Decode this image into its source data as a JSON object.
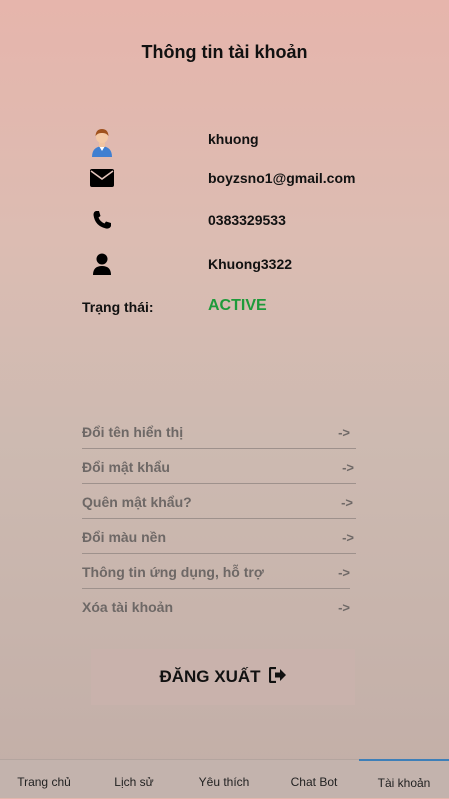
{
  "page": {
    "title": "Thông tin tài khoản"
  },
  "profile": {
    "name": "khuong",
    "email": "boyzsno1@gmail.com",
    "phone": "0383329533",
    "username": "Khuong3322",
    "status_label": "Trạng thái:",
    "status_value": "ACTIVE",
    "status_color": "#1e9a3a"
  },
  "icons": {
    "avatar": "user-avatar-icon",
    "email": "envelope-icon",
    "phone": "phone-icon",
    "username": "person-icon",
    "logout": "sign-out-icon"
  },
  "menu": [
    {
      "label": "Đổi tên hiển thị",
      "arrow": "->"
    },
    {
      "label": "Đổi mật khẩu",
      "arrow": "->"
    },
    {
      "label": "Quên mật khẩu?",
      "arrow": "->"
    },
    {
      "label": "Đổi màu nền",
      "arrow": "->"
    },
    {
      "label": "Thông tin ứng dụng, hỗ trợ",
      "arrow": "->"
    },
    {
      "label": "Xóa tài khoản",
      "arrow": "->"
    }
  ],
  "logout": {
    "label": "ĐĂNG XUẤT"
  },
  "nav": {
    "tabs": [
      "Trang chủ",
      "Lịch sử",
      "Yêu thích",
      "Chat Bot",
      "Tài khoản"
    ],
    "active": "Tài khoản",
    "accent": "#3d7fb8"
  }
}
